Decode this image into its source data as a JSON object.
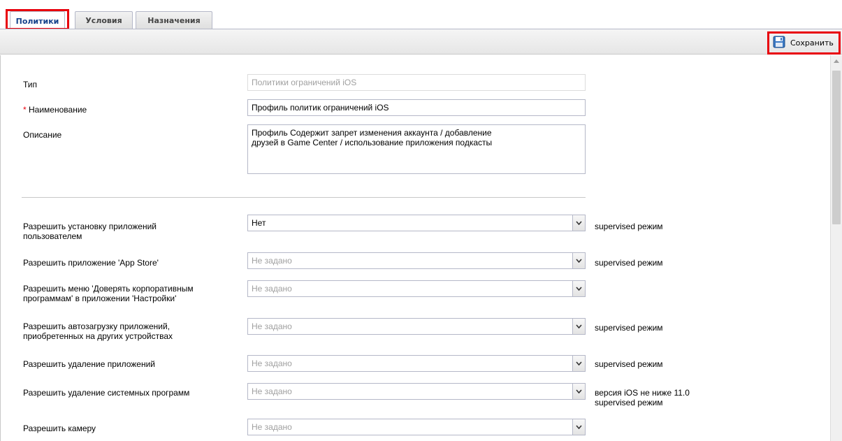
{
  "tabs": [
    {
      "label": "Политики",
      "active": true
    },
    {
      "label": "Условия",
      "active": false
    },
    {
      "label": "Назначения",
      "active": false
    }
  ],
  "toolbar": {
    "save_label": "Сохранить",
    "save_icon": "floppy-disk-icon"
  },
  "form": {
    "type_label": "Тип",
    "type_value": "Политики ограничений iOS",
    "name_required_mark": "*",
    "name_label": "Наименование",
    "name_value": "Профиль политик ограничений iOS",
    "description_label": "Описание",
    "description_value": "Профиль Содержит запрет изменения аккаунта / добавление\nдрузей в Game Center / использование приложения подкасты"
  },
  "settings": [
    {
      "label_line1": "Разрешить установку приложений",
      "label_line2": "пользователем",
      "value": "Нет",
      "note_line1": "supervised режим",
      "note_line2": ""
    },
    {
      "label_line1": "Разрешить приложение 'App Store'",
      "label_line2": "",
      "value": "Не задано",
      "note_line1": "supervised режим",
      "note_line2": ""
    },
    {
      "label_line1": "Разрешить меню 'Доверять корпоративным",
      "label_line2": "программам' в приложении 'Настройки'",
      "value": "Не задано",
      "note_line1": "",
      "note_line2": ""
    },
    {
      "label_line1": "Разрешить автозагрузку приложений,",
      "label_line2": "приобретенных на других устройствах",
      "value": "Не задано",
      "note_line1": "supervised режим",
      "note_line2": ""
    },
    {
      "label_line1": "Разрешить удаление приложений",
      "label_line2": "",
      "value": "Не задано",
      "note_line1": "supervised режим",
      "note_line2": ""
    },
    {
      "label_line1": "Разрешить удаление системных программ",
      "label_line2": "",
      "value": "Не задано",
      "note_line1": "версия iOS не ниже 11.0",
      "note_line2": "supervised режим"
    },
    {
      "label_line1": "Разрешить камеру",
      "label_line2": "",
      "value": "Не задано",
      "note_line1": "",
      "note_line2": ""
    }
  ],
  "colors": {
    "highlight": "#e8000c",
    "required": "#e8000c",
    "tab_text": "#15428b"
  }
}
